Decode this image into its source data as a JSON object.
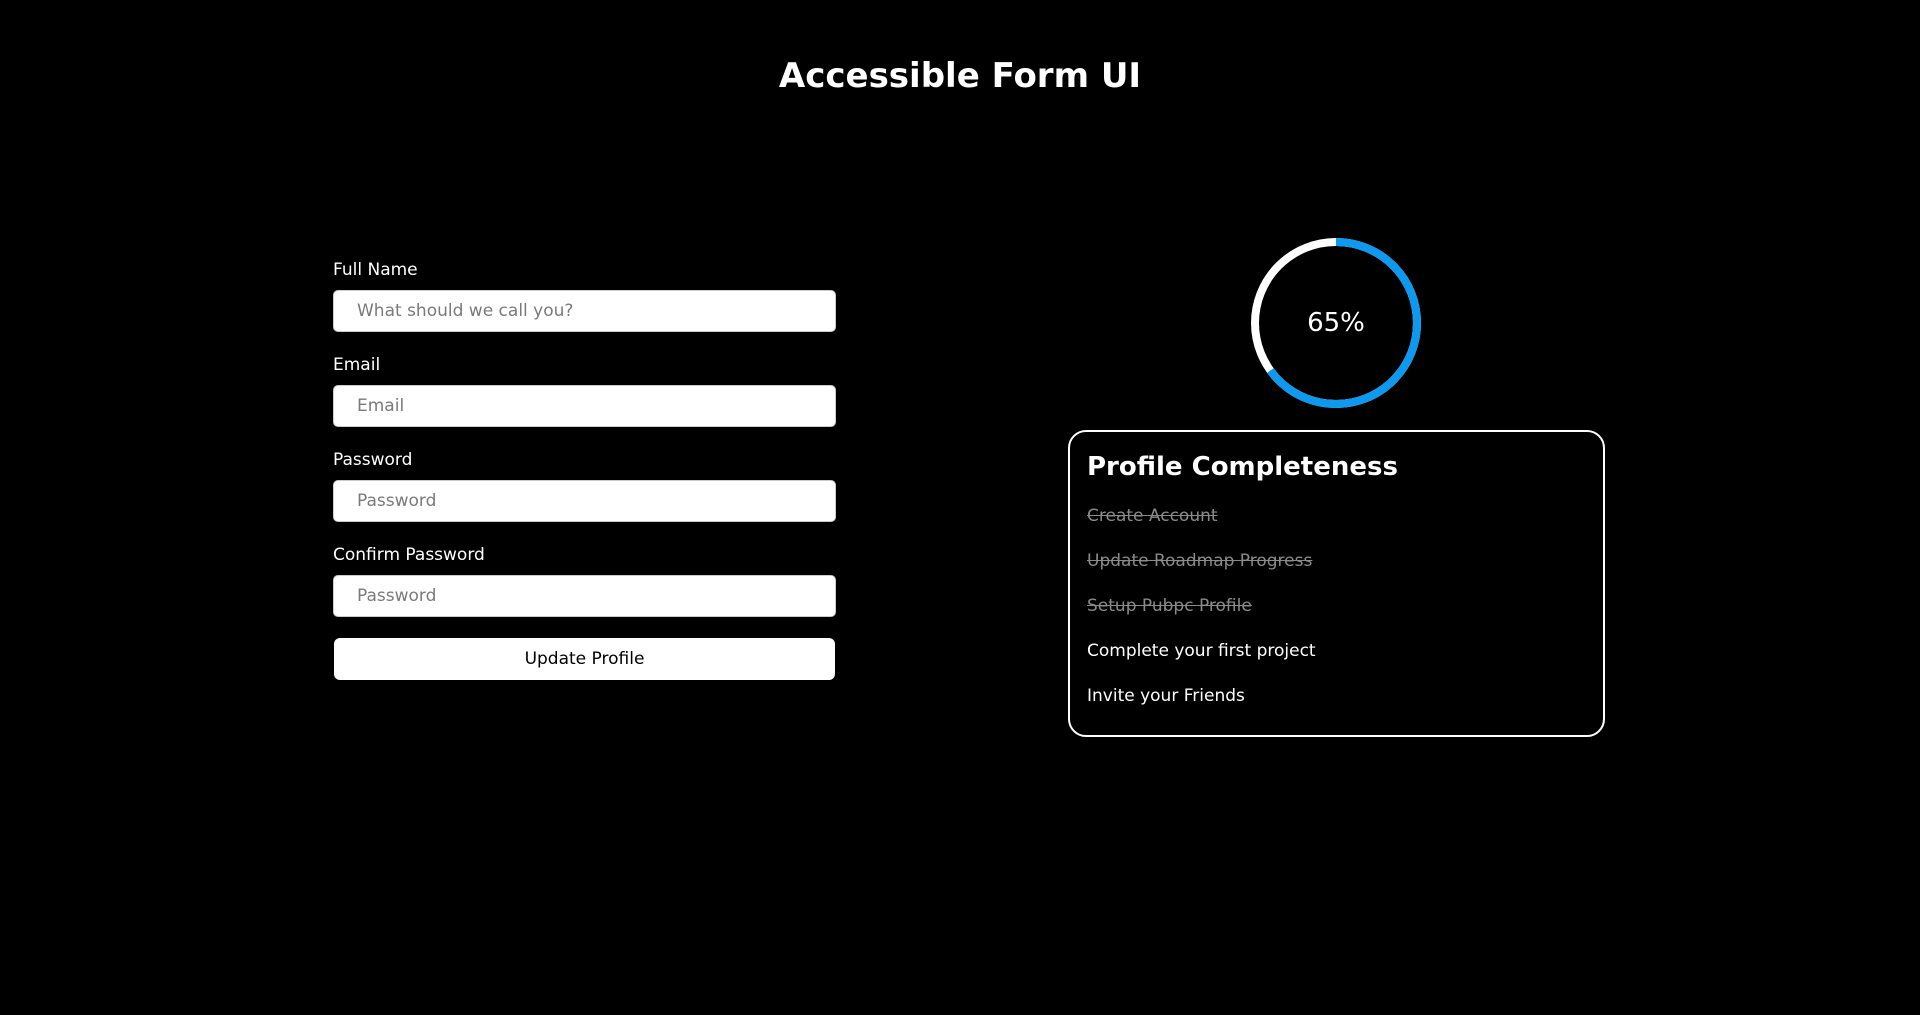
{
  "page": {
    "title": "Accessible Form UI"
  },
  "form": {
    "fields": [
      {
        "label": "Full Name",
        "placeholder": "What should we call you?",
        "value": ""
      },
      {
        "label": "Email",
        "placeholder": "Email",
        "value": ""
      },
      {
        "label": "Password",
        "placeholder": "Password",
        "value": ""
      },
      {
        "label": "Confirm Password",
        "placeholder": "Password",
        "value": ""
      }
    ],
    "submit_label": "Update Profile"
  },
  "progress": {
    "percent": 65,
    "label": "65%",
    "fill_color": "#0d99f0",
    "track_color": "#ffffff"
  },
  "completeness": {
    "title": "Profile Completeness",
    "tasks": [
      {
        "label": "Create Account",
        "done": true
      },
      {
        "label": "Update Roadmap Progress",
        "done": true
      },
      {
        "label": "Setup Pubpc Profile",
        "done": true
      },
      {
        "label": "Complete your first project",
        "done": false
      },
      {
        "label": "Invite your Friends",
        "done": false
      }
    ]
  }
}
